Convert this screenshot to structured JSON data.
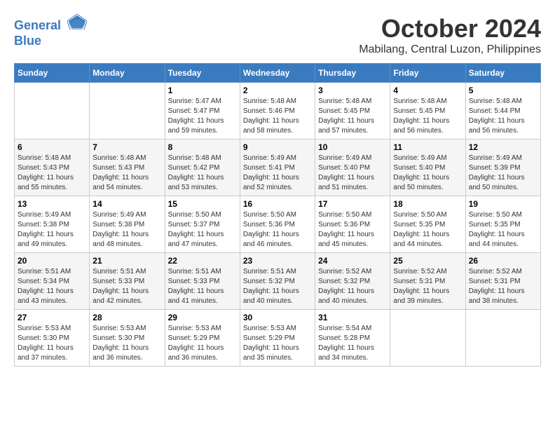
{
  "header": {
    "logo_line1": "General",
    "logo_line2": "Blue",
    "month": "October 2024",
    "location": "Mabilang, Central Luzon, Philippines"
  },
  "days_of_week": [
    "Sunday",
    "Monday",
    "Tuesday",
    "Wednesday",
    "Thursday",
    "Friday",
    "Saturday"
  ],
  "weeks": [
    [
      {
        "day": "",
        "info": ""
      },
      {
        "day": "",
        "info": ""
      },
      {
        "day": "1",
        "info": "Sunrise: 5:47 AM\nSunset: 5:47 PM\nDaylight: 11 hours and 59 minutes."
      },
      {
        "day": "2",
        "info": "Sunrise: 5:48 AM\nSunset: 5:46 PM\nDaylight: 11 hours and 58 minutes."
      },
      {
        "day": "3",
        "info": "Sunrise: 5:48 AM\nSunset: 5:45 PM\nDaylight: 11 hours and 57 minutes."
      },
      {
        "day": "4",
        "info": "Sunrise: 5:48 AM\nSunset: 5:45 PM\nDaylight: 11 hours and 56 minutes."
      },
      {
        "day": "5",
        "info": "Sunrise: 5:48 AM\nSunset: 5:44 PM\nDaylight: 11 hours and 56 minutes."
      }
    ],
    [
      {
        "day": "6",
        "info": "Sunrise: 5:48 AM\nSunset: 5:43 PM\nDaylight: 11 hours and 55 minutes."
      },
      {
        "day": "7",
        "info": "Sunrise: 5:48 AM\nSunset: 5:43 PM\nDaylight: 11 hours and 54 minutes."
      },
      {
        "day": "8",
        "info": "Sunrise: 5:48 AM\nSunset: 5:42 PM\nDaylight: 11 hours and 53 minutes."
      },
      {
        "day": "9",
        "info": "Sunrise: 5:49 AM\nSunset: 5:41 PM\nDaylight: 11 hours and 52 minutes."
      },
      {
        "day": "10",
        "info": "Sunrise: 5:49 AM\nSunset: 5:40 PM\nDaylight: 11 hours and 51 minutes."
      },
      {
        "day": "11",
        "info": "Sunrise: 5:49 AM\nSunset: 5:40 PM\nDaylight: 11 hours and 50 minutes."
      },
      {
        "day": "12",
        "info": "Sunrise: 5:49 AM\nSunset: 5:39 PM\nDaylight: 11 hours and 50 minutes."
      }
    ],
    [
      {
        "day": "13",
        "info": "Sunrise: 5:49 AM\nSunset: 5:38 PM\nDaylight: 11 hours and 49 minutes."
      },
      {
        "day": "14",
        "info": "Sunrise: 5:49 AM\nSunset: 5:38 PM\nDaylight: 11 hours and 48 minutes."
      },
      {
        "day": "15",
        "info": "Sunrise: 5:50 AM\nSunset: 5:37 PM\nDaylight: 11 hours and 47 minutes."
      },
      {
        "day": "16",
        "info": "Sunrise: 5:50 AM\nSunset: 5:36 PM\nDaylight: 11 hours and 46 minutes."
      },
      {
        "day": "17",
        "info": "Sunrise: 5:50 AM\nSunset: 5:36 PM\nDaylight: 11 hours and 45 minutes."
      },
      {
        "day": "18",
        "info": "Sunrise: 5:50 AM\nSunset: 5:35 PM\nDaylight: 11 hours and 44 minutes."
      },
      {
        "day": "19",
        "info": "Sunrise: 5:50 AM\nSunset: 5:35 PM\nDaylight: 11 hours and 44 minutes."
      }
    ],
    [
      {
        "day": "20",
        "info": "Sunrise: 5:51 AM\nSunset: 5:34 PM\nDaylight: 11 hours and 43 minutes."
      },
      {
        "day": "21",
        "info": "Sunrise: 5:51 AM\nSunset: 5:33 PM\nDaylight: 11 hours and 42 minutes."
      },
      {
        "day": "22",
        "info": "Sunrise: 5:51 AM\nSunset: 5:33 PM\nDaylight: 11 hours and 41 minutes."
      },
      {
        "day": "23",
        "info": "Sunrise: 5:51 AM\nSunset: 5:32 PM\nDaylight: 11 hours and 40 minutes."
      },
      {
        "day": "24",
        "info": "Sunrise: 5:52 AM\nSunset: 5:32 PM\nDaylight: 11 hours and 40 minutes."
      },
      {
        "day": "25",
        "info": "Sunrise: 5:52 AM\nSunset: 5:31 PM\nDaylight: 11 hours and 39 minutes."
      },
      {
        "day": "26",
        "info": "Sunrise: 5:52 AM\nSunset: 5:31 PM\nDaylight: 11 hours and 38 minutes."
      }
    ],
    [
      {
        "day": "27",
        "info": "Sunrise: 5:53 AM\nSunset: 5:30 PM\nDaylight: 11 hours and 37 minutes."
      },
      {
        "day": "28",
        "info": "Sunrise: 5:53 AM\nSunset: 5:30 PM\nDaylight: 11 hours and 36 minutes."
      },
      {
        "day": "29",
        "info": "Sunrise: 5:53 AM\nSunset: 5:29 PM\nDaylight: 11 hours and 36 minutes."
      },
      {
        "day": "30",
        "info": "Sunrise: 5:53 AM\nSunset: 5:29 PM\nDaylight: 11 hours and 35 minutes."
      },
      {
        "day": "31",
        "info": "Sunrise: 5:54 AM\nSunset: 5:28 PM\nDaylight: 11 hours and 34 minutes."
      },
      {
        "day": "",
        "info": ""
      },
      {
        "day": "",
        "info": ""
      }
    ]
  ]
}
